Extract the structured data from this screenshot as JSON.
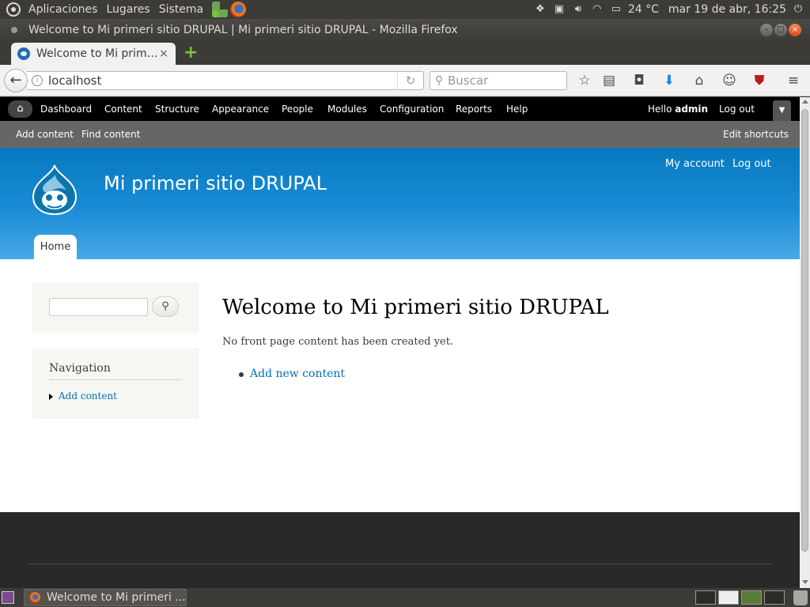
{
  "top_panel": {
    "menus": [
      "Aplicaciones",
      "Lugares",
      "Sistema"
    ],
    "temperature": "24 °C",
    "clock": "mar 19 de abr, 16:25"
  },
  "window": {
    "title": "Welcome to Mi primeri sitio DRUPAL | Mi primeri sitio DRUPAL - Mozilla Firefox"
  },
  "browser": {
    "tab_title": "Welcome to Mi prim…",
    "url": "localhost",
    "search_placeholder": "Buscar"
  },
  "drupal_toolbar": {
    "menu": [
      "Dashboard",
      "Content",
      "Structure",
      "Appearance",
      "People",
      "Modules",
      "Configuration",
      "Reports",
      "Help"
    ],
    "hello_prefix": "Hello ",
    "user": "admin",
    "logout": "Log out"
  },
  "shortcuts": {
    "items": [
      "Add content",
      "Find content"
    ],
    "edit": "Edit shortcuts"
  },
  "header": {
    "site_name": "Mi primeri sitio DRUPAL",
    "my_account": "My account",
    "logout": "Log out",
    "home_tab": "Home"
  },
  "sidebar": {
    "nav_title": "Navigation",
    "nav_items": [
      "Add content"
    ]
  },
  "main": {
    "title": "Welcome to Mi primeri sitio DRUPAL",
    "message": "No front page content has been created yet.",
    "links": [
      "Add new content"
    ]
  },
  "taskbar": {
    "task_label": "Welcome to Mi primeri ..."
  },
  "colors": {
    "drupal_blue": "#0779bf",
    "link": "#0071b3"
  }
}
